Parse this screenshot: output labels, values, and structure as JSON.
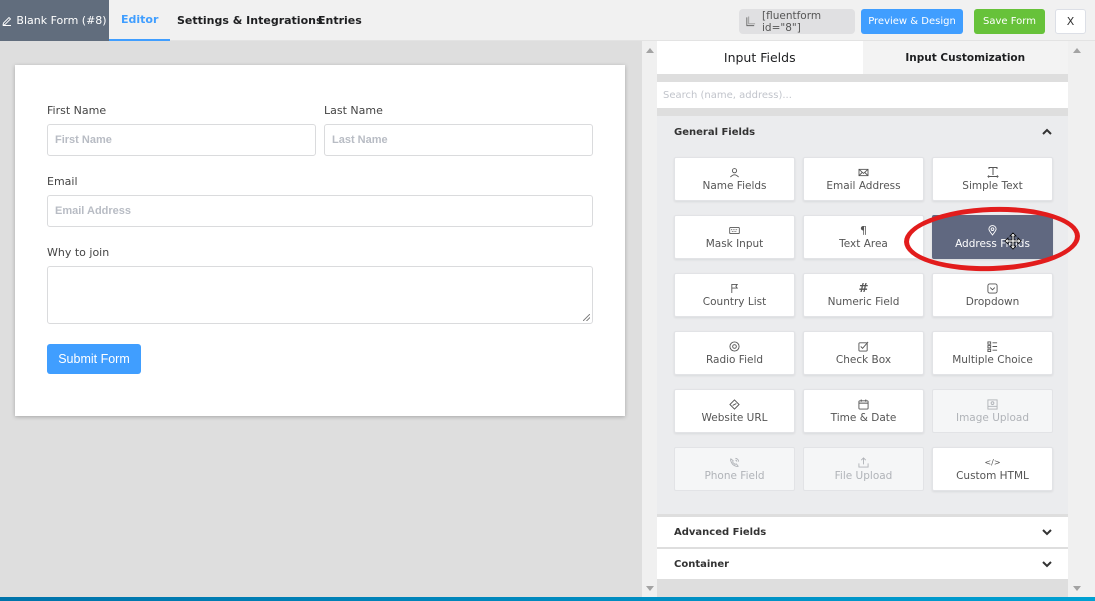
{
  "topbar": {
    "form_title": "Blank Form (#8)",
    "tabs": [
      {
        "label": "Editor",
        "active": true
      },
      {
        "label": "Settings & Integrations",
        "active": false
      },
      {
        "label": "Entries",
        "active": false
      }
    ],
    "shortcode": "[fluentform id=\"8\"]",
    "preview_label": "Preview & Design",
    "save_label": "Save Form",
    "close_label": "X"
  },
  "form": {
    "first_name": {
      "label": "First Name",
      "placeholder": "First Name"
    },
    "last_name": {
      "label": "Last Name",
      "placeholder": "Last Name"
    },
    "email": {
      "label": "Email",
      "placeholder": "Email Address"
    },
    "why_join": {
      "label": "Why to join",
      "value": ""
    },
    "submit_label": "Submit Form"
  },
  "sidebar": {
    "tabs": [
      {
        "label": "Input Fields",
        "active": true
      },
      {
        "label": "Input Customization",
        "active": false
      }
    ],
    "search_placeholder": "Search (name, address)...",
    "general_title": "General Fields",
    "general_fields": [
      {
        "label": "Name Fields",
        "icon": "user-icon",
        "state": "normal"
      },
      {
        "label": "Email Address",
        "icon": "envelope-icon",
        "state": "normal"
      },
      {
        "label": "Simple Text",
        "icon": "text-icon",
        "state": "normal"
      },
      {
        "label": "Mask Input",
        "icon": "keyboard-icon",
        "state": "normal"
      },
      {
        "label": "Text Area",
        "icon": "paragraph-icon",
        "state": "normal"
      },
      {
        "label": "Address Fields",
        "icon": "location-pin-icon",
        "state": "hover"
      },
      {
        "label": "Country List",
        "icon": "flag-icon",
        "state": "normal"
      },
      {
        "label": "Numeric Field",
        "icon": "hash-icon",
        "state": "normal"
      },
      {
        "label": "Dropdown",
        "icon": "dropdown-icon",
        "state": "normal"
      },
      {
        "label": "Radio Field",
        "icon": "radio-icon",
        "state": "normal"
      },
      {
        "label": "Check Box",
        "icon": "checkbox-icon",
        "state": "normal"
      },
      {
        "label": "Multiple Choice",
        "icon": "list-icon",
        "state": "normal"
      },
      {
        "label": "Website URL",
        "icon": "link-icon",
        "state": "normal"
      },
      {
        "label": "Time & Date",
        "icon": "calendar-icon",
        "state": "normal"
      },
      {
        "label": "Image Upload",
        "icon": "image-icon",
        "state": "disabled"
      },
      {
        "label": "Phone Field",
        "icon": "phone-icon",
        "state": "disabled"
      },
      {
        "label": "File Upload",
        "icon": "upload-icon",
        "state": "disabled"
      },
      {
        "label": "Custom HTML",
        "icon": "code-icon",
        "state": "normal"
      }
    ],
    "advanced_title": "Advanced Fields",
    "container_title": "Container"
  },
  "colors": {
    "primary": "#409eff",
    "success": "#67c23a",
    "title_bg": "#616d7d",
    "hover_field": "#606880",
    "highlight": "#e21c1c"
  }
}
